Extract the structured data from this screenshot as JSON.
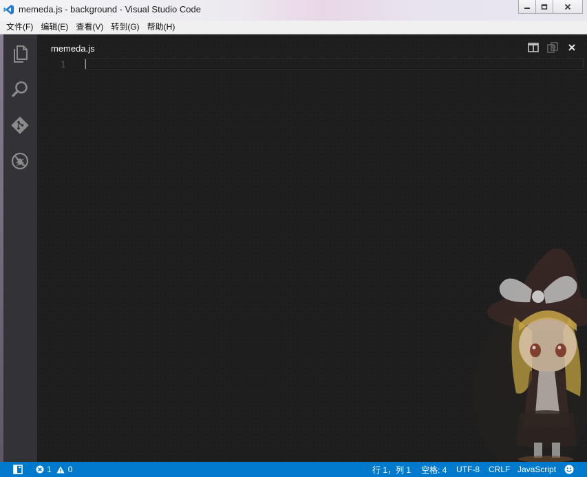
{
  "window": {
    "title": "memeda.js - background - Visual Studio Code",
    "accent": "#007acc"
  },
  "menubar": {
    "items": [
      "文件(F)",
      "编辑(E)",
      "查看(V)",
      "转到(G)",
      "帮助(H)"
    ]
  },
  "activitybar": {
    "icons": [
      "explorer-icon",
      "search-icon",
      "git-icon",
      "debug-icon"
    ]
  },
  "editor": {
    "tab": "memeda.js",
    "line_number": "1"
  },
  "statusbar": {
    "errors": "1",
    "warnings": "0",
    "position": "行 1，列 1",
    "indent": "空格: 4",
    "encoding": "UTF-8",
    "eol": "CRLF",
    "language": "JavaScript"
  }
}
